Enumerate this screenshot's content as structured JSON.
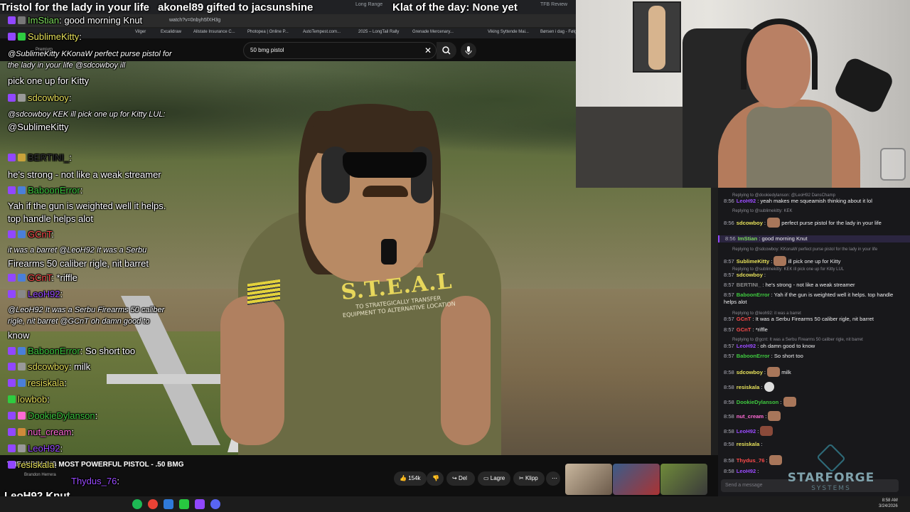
{
  "banner": {
    "left_text": "Tristol for the lady in your life",
    "gift_text": "akonel89 gifted to jacsunshine",
    "klat_text": "Klat of the day: None yet"
  },
  "browser": {
    "tabs": [
      "TFB Review",
      "Long Range |"
    ],
    "address": "watch?v=0nbyh5fXH3g",
    "bookmarks": [
      "Vilger",
      "Excalidraw",
      "Allstate Insurance C...",
      "Photopea | Online P...",
      "AutoTempest.com...",
      "2025 – LongTail Rally",
      "Grenade Mercenary...",
      "Viking Syttende Mai...",
      "Børsen i dag - Følg..."
    ],
    "youtube_premium": "Premium",
    "search_value": "50 bmg pistol"
  },
  "video": {
    "shirt_title": "S.T.E.A.L",
    "shirt_sub": "TO STRATEGICALLY TRANSFER EQUIPMENT TO ALTERNATIVE LOCATION",
    "title": "THE WORLD'S MOST POWERFUL PISTOL - .50 BMG",
    "channel": "Brandon Herrera",
    "likes": "154k",
    "share": "Del",
    "save": "Lagre",
    "clip": "Klipp"
  },
  "overlay_chat": [
    {
      "user": "ImStian",
      "text": "good morning Knut",
      "color": "#7ddc5d"
    },
    {
      "user": "SublimeKitty",
      "text": "",
      "color": "#e6e05a"
    },
    {
      "user": "",
      "text": "@SublimeKitty KKonaW perfect purse pistol for",
      "color": "#fff",
      "italic": true
    },
    {
      "user": "",
      "text": "the lady in your life  @sdcowboy   ill",
      "color": "#fff",
      "italic": true
    },
    {
      "user": "",
      "text": "pick one up for Kitty",
      "color": "#fff"
    },
    {
      "user": "sdcowboy",
      "text": "",
      "color": "#e6e05a"
    },
    {
      "user": "",
      "text": "@sdcowboy KEK ill pick one up for Kitty LUL:",
      "color": "#fff",
      "italic": true
    },
    {
      "user": "",
      "text": "@SublimeKitty",
      "color": "#fff"
    },
    {
      "user": "BERTINI_",
      "text": "",
      "color": "#333"
    },
    {
      "user": "",
      "text": "he's strong - not like a weak streamer",
      "color": "#fff"
    },
    {
      "user": "BaboonError",
      "text": "",
      "color": "#3fc93f"
    },
    {
      "user": "",
      "text": "Yah if the gun is weighted well it helps.",
      "color": "#fff"
    },
    {
      "user": "",
      "text": "top handle helps alot",
      "color": "#fff"
    },
    {
      "user": "GCnT",
      "text": "",
      "color": "#ff4b4b"
    },
    {
      "user": "",
      "text": "it was a barret  @LeoH92 It was a Serbu",
      "color": "#fff",
      "italic": true
    },
    {
      "user": "",
      "text": "Firearms 50 caliber rigle, nit barret",
      "color": "#fff"
    },
    {
      "user": "GCnT",
      "text": "*riffle",
      "color": "#ff4b4b"
    },
    {
      "user": "LeoH92",
      "text": "",
      "color": "#9a4bff"
    },
    {
      "user": "",
      "text": "@LeoH92 It was a Serbu Firearms 50 caliber",
      "color": "#fff",
      "italic": true
    },
    {
      "user": "",
      "text": "rigle, nit barret  @GCnT oh damn good to",
      "color": "#fff",
      "italic": true
    },
    {
      "user": "",
      "text": "know",
      "color": "#fff"
    },
    {
      "user": "BaboonError",
      "text": "So short too",
      "color": "#3fc93f"
    },
    {
      "user": "sdcowboy",
      "text": "milk",
      "color": "#e6e05a"
    },
    {
      "user": "resiskala",
      "text": "",
      "color": "#e6e05a"
    },
    {
      "user": "lowbob",
      "text": "",
      "color": "#e6e05a"
    },
    {
      "user": "DookieDylanson",
      "text": "",
      "color": "#3fc93f"
    },
    {
      "user": "nut_cream",
      "text": "",
      "color": "#ff6ad5"
    },
    {
      "user": "LeoH92",
      "text": "",
      "color": "#9a4bff"
    },
    {
      "user": "resiskala",
      "text": "",
      "color": "#e6e05a"
    },
    {
      "user": "Thydus_76",
      "text": "",
      "color": "#9a4bff"
    }
  ],
  "bottom_overlay": "LeoH92 Knut",
  "chat": [
    {
      "reply": "Replying to @dookiedylanson: @LeoH92 DansChamp"
    },
    {
      "time": "8:56",
      "user": "LeoH92",
      "text": "yeah makes me squeamish thinking about it lol",
      "color": "#9a4bff"
    },
    {
      "reply": "Replying to @sublimekitty: KEK"
    },
    {
      "time": "8:56",
      "user": "sdcowboy",
      "text": "perfect purse pistol for the lady in your life",
      "color": "#e6e05a"
    },
    {
      "time": "8:56",
      "user": "ImStian",
      "text": "good morning Knut",
      "color": "#7ddc5d",
      "highlight": true
    },
    {
      "reply": "Replying to @sdcowboy: KKonaW perfect purse pistol for the lady in your life"
    },
    {
      "time": "8:57",
      "user": "SublimeKitty",
      "text": "ill pick one up for Kitty",
      "color": "#e6e05a"
    },
    {
      "reply": "Replying to @sublimekitty: KEK ill pick one up for Kitty LUL"
    },
    {
      "time": "8:57",
      "user": "sdcowboy",
      "text": "",
      "color": "#e6e05a"
    },
    {
      "time": "8:57",
      "user": "BERTINI_",
      "text": "he's strong - not like a weak streamer",
      "color": "#8a8a8a"
    },
    {
      "time": "8:57",
      "user": "BaboonError",
      "text": "Yah if the gun is weighted well it helps. top handle helps alot",
      "color": "#3fc93f"
    },
    {
      "reply": "Replying to @leoh92: it was a barret"
    },
    {
      "time": "8:57",
      "user": "GCnT",
      "text": "It was a Serbu Firearms 50 caliber rigle, nit barret",
      "color": "#ff4b4b"
    },
    {
      "time": "8:57",
      "user": "GCnT",
      "text": "*riffle",
      "color": "#ff4b4b"
    },
    {
      "reply": "Replying to @gcnt: It was a Serbu Firearms 50 caliber rigle, nit barret"
    },
    {
      "time": "8:57",
      "user": "LeoH92",
      "text": "oh damn good to know",
      "color": "#9a4bff"
    },
    {
      "time": "8:57",
      "user": "BaboonError",
      "text": "So short too",
      "color": "#3fc93f"
    },
    {
      "time": "8:58",
      "user": "sdcowboy",
      "text": "milk",
      "color": "#e6e05a"
    },
    {
      "time": "8:58",
      "user": "resiskala",
      "text": "",
      "color": "#e6e05a"
    },
    {
      "time": "8:58",
      "user": "DookieDylanson",
      "text": "",
      "color": "#3fc93f"
    },
    {
      "time": "8:58",
      "user": "nut_cream",
      "text": "",
      "color": "#ff6ad5"
    },
    {
      "time": "8:58",
      "user": "LeoH92",
      "text": "",
      "color": "#9a4bff"
    },
    {
      "time": "8:58",
      "user": "resiskala",
      "text": "",
      "color": "#e6e05a"
    },
    {
      "time": "8:58",
      "user": "Thydus_76",
      "text": "",
      "color": "#ff4b4b"
    },
    {
      "time": "8:58",
      "user": "LeoH92",
      "text": "",
      "color": "#9a4bff"
    }
  ],
  "chat_input_placeholder": "Send a message",
  "logo": {
    "name": "STARFORGE",
    "sub": "SYSTEMS"
  },
  "tray": {
    "time": "8:58 AM",
    "date": "3/24/2026"
  },
  "colors": {
    "chat_bg": "#18181b",
    "accent": "#9147ff",
    "video_bar": "#0f0f0f"
  }
}
